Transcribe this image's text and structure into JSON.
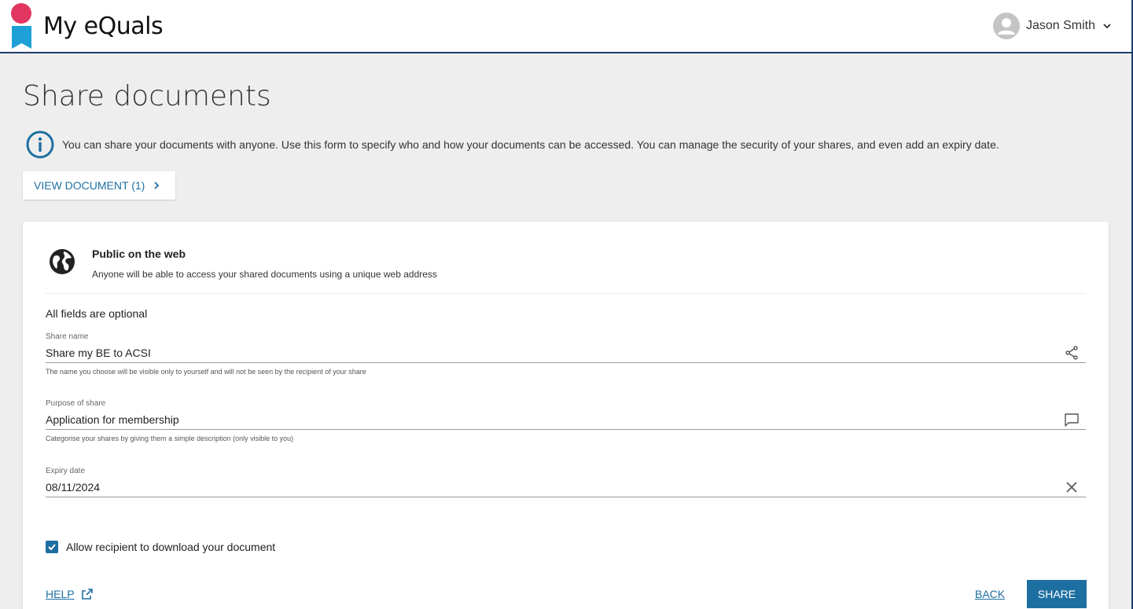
{
  "header": {
    "brand": "My eQuals",
    "user_name": "Jason Smith"
  },
  "page": {
    "title": "Share documents",
    "info": "You can share your documents with anyone. Use this form to specify who and how your documents can be accessed. You can manage the security of your shares, and even add an expiry date.",
    "view_document": "VIEW DOCUMENT (1)"
  },
  "card": {
    "mode_title": "Public on the web",
    "mode_desc": "Anyone will be able to access your shared documents using a unique web address",
    "optional_note": "All fields are optional",
    "fields": {
      "share_name": {
        "label": "Share name",
        "value": "Share my BE to ACSI",
        "hint": "The name you choose will be visible only to yourself and will not be seen by the recipient of your share"
      },
      "purpose": {
        "label": "Purpose of share",
        "value": "Application for membership",
        "hint": "Categorise your shares by giving them a simple description (only visible to you)"
      },
      "expiry": {
        "label": "Expiry date",
        "value": "08/11/2024"
      }
    },
    "download_checkbox": {
      "label": "Allow recipient to download your document",
      "checked": true
    },
    "help_label": "HELP",
    "back_label": "BACK",
    "share_label": "SHARE"
  },
  "colors": {
    "accent": "#1e6fa1",
    "brand_pink": "#e0365f",
    "brand_blue": "#1da1d6",
    "header_border": "#1f3c6e"
  },
  "icons": {
    "logo": "my-equals-logo",
    "avatar": "user-avatar-icon",
    "user_menu": "chevron-down-icon",
    "info": "info-circle-icon",
    "view_document": "chevron-right-icon",
    "mode": "globe-icon",
    "share_name": "share-icon",
    "purpose": "comment-icon",
    "expiry": "close-icon",
    "help": "external-link-icon",
    "checkbox": "checkmark-icon"
  }
}
